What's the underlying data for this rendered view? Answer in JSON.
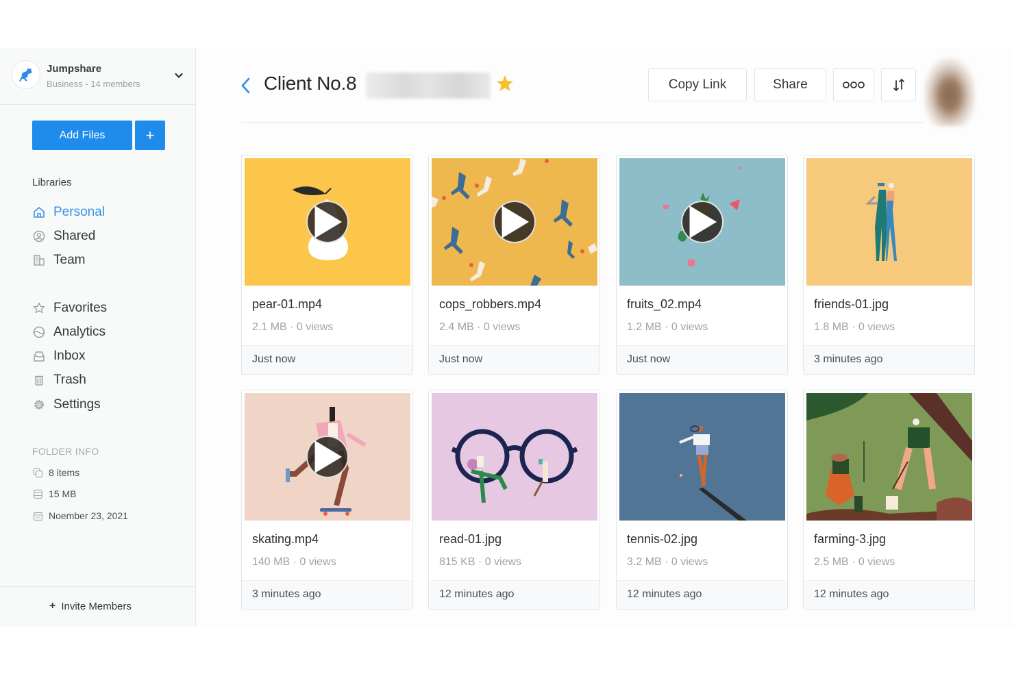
{
  "org": {
    "name": "Jumpshare",
    "subtitle": "Business - 14 members",
    "logo_icon": "kangaroo-logo-icon",
    "menu_icon": "chevron-down-icon"
  },
  "actions": {
    "add_files": "Add Files",
    "add_plus": "+"
  },
  "libraries": {
    "label": "Libraries",
    "items": [
      {
        "label": "Personal",
        "icon": "home-icon",
        "active": true
      },
      {
        "label": "Shared",
        "icon": "shared-user-icon",
        "active": false
      },
      {
        "label": "Team",
        "icon": "team-building-icon",
        "active": false
      }
    ]
  },
  "nav": {
    "items": [
      {
        "label": "Favorites",
        "icon": "star-outline-icon"
      },
      {
        "label": "Analytics",
        "icon": "analytics-icon"
      },
      {
        "label": "Inbox",
        "icon": "inbox-icon"
      },
      {
        "label": "Trash",
        "icon": "trash-icon"
      },
      {
        "label": "Settings",
        "icon": "gear-icon"
      }
    ]
  },
  "folder_info": {
    "title": "FOLDER INFO",
    "items": [
      {
        "text": "8 items",
        "icon": "copy-items-icon"
      },
      {
        "text": "15 MB",
        "icon": "storage-icon"
      },
      {
        "text": "Noember 23, 2021",
        "icon": "calendar-icon"
      }
    ]
  },
  "invite": {
    "label": "Invite Members",
    "icon": "+"
  },
  "header": {
    "title": "Client No.8",
    "back_icon": "chevron-left-icon",
    "favorite_icon": "star-filled-icon",
    "buttons": {
      "copy_link": "Copy Link",
      "share": "Share",
      "more": "ooo",
      "sort_icon": "sort-icon"
    }
  },
  "colors": {
    "accent": "#1f8ceb",
    "star": "#f5c02b"
  },
  "files": [
    {
      "name": "pear-01.mp4",
      "meta": "2.1 MB · 0 views",
      "time": "Just now",
      "type": "video",
      "thumb_bg": "#fcc64a"
    },
    {
      "name": "cops_robbers.mp4",
      "meta": "2.4 MB · 0 views",
      "time": "Just now",
      "type": "video",
      "thumb_bg": "#efb84e"
    },
    {
      "name": "fruits_02.mp4",
      "meta": "1.2 MB · 0 views",
      "time": "Just now",
      "type": "video",
      "thumb_bg": "#8dbdc8"
    },
    {
      "name": "friends-01.jpg",
      "meta": "1.8 MB · 0 views",
      "time": "3 minutes ago",
      "type": "image",
      "thumb_bg": "#f7c97c"
    },
    {
      "name": "skating.mp4",
      "meta": "140 MB · 0 views",
      "time": "3 minutes ago",
      "type": "video",
      "thumb_bg": "#f0d4c5"
    },
    {
      "name": "read-01.jpg",
      "meta": "815 KB · 0 views",
      "time": "12 minutes ago",
      "type": "image",
      "thumb_bg": "#e6c8e2"
    },
    {
      "name": "tennis-02.jpg",
      "meta": "3.2 MB · 0 views",
      "time": "12 minutes ago",
      "type": "image",
      "thumb_bg": "#527596"
    },
    {
      "name": "farming-3.jpg",
      "meta": "2.5 MB · 0 views",
      "time": "12 minutes ago",
      "type": "image",
      "thumb_bg": "#7f9a57"
    }
  ]
}
